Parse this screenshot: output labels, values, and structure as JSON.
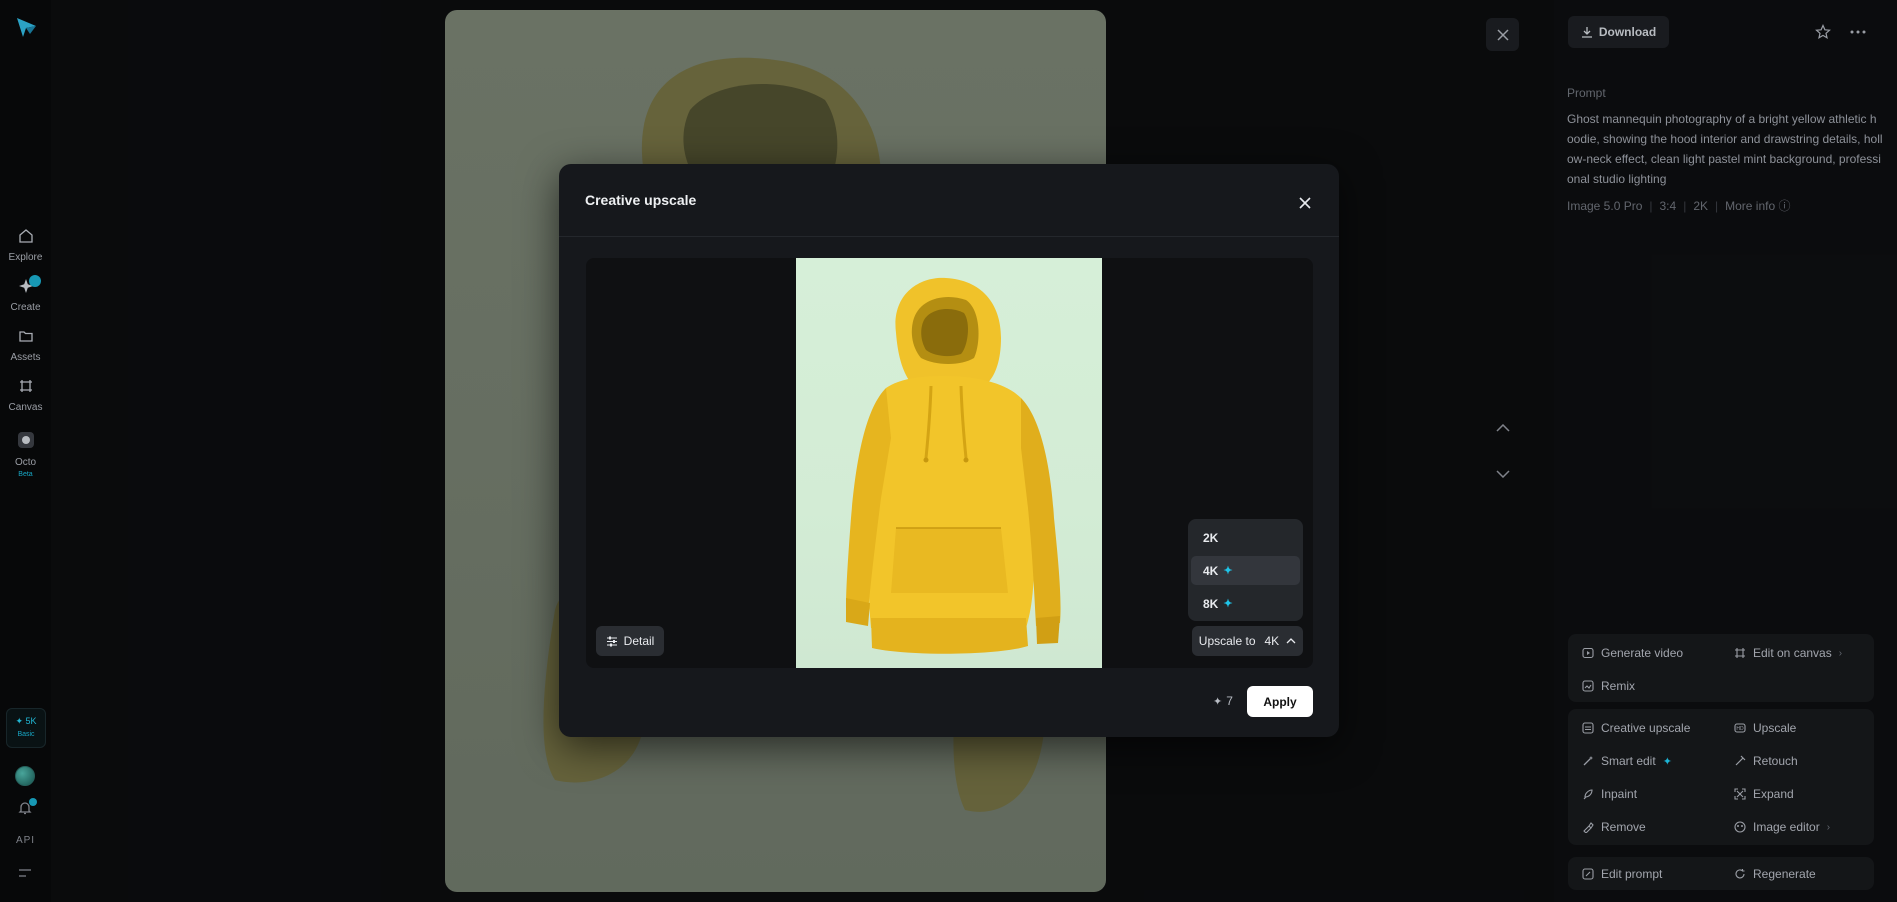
{
  "sidebar": {
    "items": [
      {
        "label": "Explore",
        "icon": "home-icon"
      },
      {
        "label": "Create",
        "icon": "sparkle-icon"
      },
      {
        "label": "Assets",
        "icon": "folder-icon"
      },
      {
        "label": "Canvas",
        "icon": "canvas-icon"
      },
      {
        "label": "Octo",
        "icon": "octo-icon",
        "tag": "Beta"
      }
    ],
    "credits": {
      "amount": "5K",
      "plan": "Basic"
    },
    "api_label": "API"
  },
  "viewer": {
    "download_label": "Download",
    "prompt_label": "Prompt",
    "prompt_text": "Ghost mannequin photography of a bright yellow athletic hoodie, showing the hood interior and drawstring details, hollow-neck effect, clean light pastel mint background, professional studio lighting",
    "meta": {
      "model": "Image 5.0 Pro",
      "ratio": "3:4",
      "resolution": "2K",
      "more_info": "More info"
    }
  },
  "actions": {
    "group1": [
      {
        "label": "Generate video",
        "icon": "video-icon"
      },
      {
        "label": "Edit on canvas",
        "icon": "canvas-icon",
        "chevron": true
      },
      {
        "label": "Remix",
        "icon": "remix-icon"
      }
    ],
    "group2": [
      {
        "label": "Creative upscale",
        "icon": "creative-upscale-icon"
      },
      {
        "label": "Upscale",
        "icon": "upscale-icon"
      },
      {
        "label": "Smart edit",
        "icon": "smart-edit-icon",
        "sparkle": true
      },
      {
        "label": "Retouch",
        "icon": "retouch-icon"
      },
      {
        "label": "Inpaint",
        "icon": "inpaint-icon"
      },
      {
        "label": "Expand",
        "icon": "expand-icon"
      },
      {
        "label": "Remove",
        "icon": "remove-icon"
      },
      {
        "label": "Image editor",
        "icon": "image-editor-icon",
        "chevron": true
      }
    ],
    "group3": [
      {
        "label": "Edit prompt",
        "icon": "edit-prompt-icon"
      },
      {
        "label": "Regenerate",
        "icon": "regenerate-icon"
      }
    ]
  },
  "modal": {
    "title": "Creative upscale",
    "detail_label": "Detail",
    "upscale_prefix": "Upscale to",
    "upscale_value": "4K",
    "options": [
      {
        "label": "2K",
        "premium": false,
        "selected": false
      },
      {
        "label": "4K",
        "premium": true,
        "selected": true
      },
      {
        "label": "8K",
        "premium": true,
        "selected": false
      }
    ],
    "cost": "7",
    "apply_label": "Apply"
  },
  "colors": {
    "accent": "#1fc4e8",
    "background": "#0b0c0e",
    "modal": "#16181c",
    "hoodie": "#f2c52a",
    "mint": "#d6efd8"
  }
}
